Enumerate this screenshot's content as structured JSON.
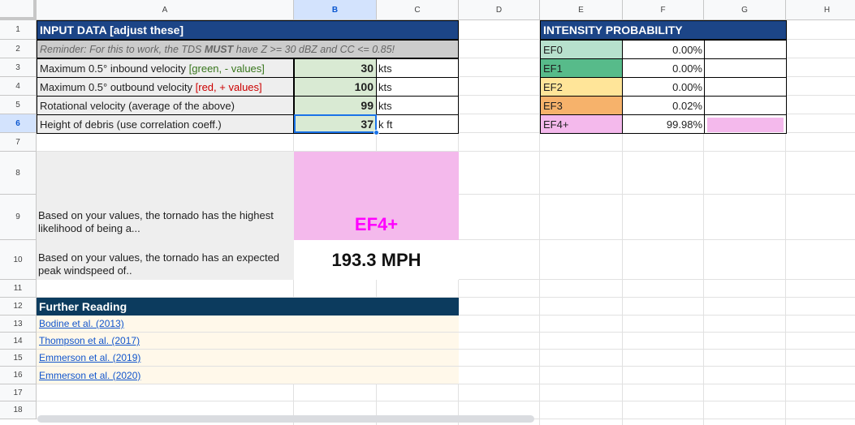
{
  "columns": [
    "A",
    "B",
    "C",
    "D",
    "E",
    "F",
    "G",
    "H"
  ],
  "rows": [
    "1",
    "2",
    "3",
    "4",
    "5",
    "6",
    "7",
    "8",
    "9",
    "10",
    "11",
    "12",
    "13",
    "14",
    "15",
    "16",
    "17",
    "18"
  ],
  "selection": {
    "column": "B",
    "row": "6"
  },
  "input": {
    "header": "INPUT DATA [adjust these]",
    "reminder_pre": "Reminder: For this to work, the TDS ",
    "reminder_bold": "MUST",
    "reminder_post": " have Z >= 30 dBZ and CC <= 0.85!",
    "rows": [
      {
        "label": "Maximum 0.5° inbound velocity ",
        "note": "[green, - values]",
        "note_color": "#38761d",
        "value": "30",
        "unit": "kts"
      },
      {
        "label": "Maximum 0.5° outbound velocity ",
        "note": "[red, + values]",
        "note_color": "#cc0000",
        "value": "100",
        "unit": "kts"
      },
      {
        "label": "Rotational velocity (average of the above)",
        "note": "",
        "note_color": "#1f1f1f",
        "value": "99",
        "unit": "kts"
      },
      {
        "label": "Height of debris (use correlation coeff.)",
        "note": "",
        "note_color": "#1f1f1f",
        "value": "37",
        "unit": "k ft"
      }
    ]
  },
  "result": {
    "likelihood_text": "Based on your values, the tornado has the highest likelihood of being a...",
    "rating": "EF4+",
    "rating_color": "#ff00ff",
    "rating_bg": "#f4b9ec",
    "windspeed_text": "Based on your values, the tornado has an expected peak windspeed of..",
    "windspeed": "193.3 MPH"
  },
  "reading": {
    "header": "Further Reading",
    "links": [
      "Bodine et al. (2013)",
      "Thompson et al. (2017)",
      "Emmerson et al. (2019)",
      "Emmerson et al. (2020)"
    ]
  },
  "intensity": {
    "header": "INTENSITY PROBABILITY",
    "rows": [
      {
        "label": "EF0",
        "pct": "0.00%",
        "color": "#b7e1cd",
        "fraction": 0.0
      },
      {
        "label": "EF1",
        "pct": "0.00%",
        "color": "#57bb8a",
        "fraction": 0.0
      },
      {
        "label": "EF2",
        "pct": "0.00%",
        "color": "#ffe599",
        "fraction": 0.0
      },
      {
        "label": "EF3",
        "pct": "0.02%",
        "color": "#f6b26b",
        "fraction": 0.0002
      },
      {
        "label": "EF4+",
        "pct": "99.98%",
        "color": "#f4b9ec",
        "fraction": 0.9998
      }
    ]
  }
}
